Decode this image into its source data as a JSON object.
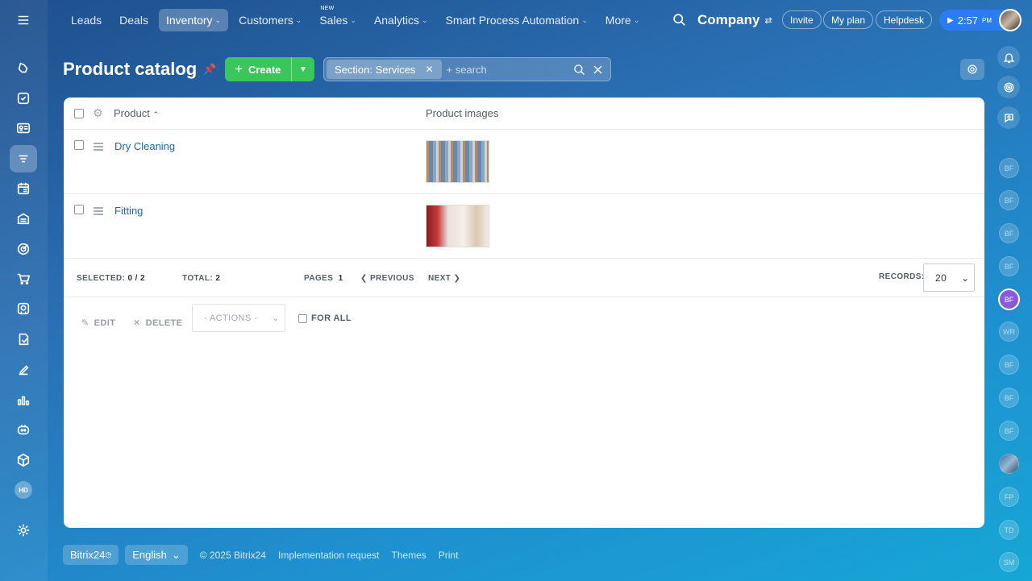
{
  "topnav": {
    "items": [
      {
        "label": "Leads",
        "chevron": false
      },
      {
        "label": "Deals",
        "chevron": false
      },
      {
        "label": "Inventory",
        "chevron": true,
        "active": true
      },
      {
        "label": "Customers",
        "chevron": true
      },
      {
        "label": "Sales",
        "chevron": true,
        "tag": "NEW"
      },
      {
        "label": "Analytics",
        "chevron": true
      },
      {
        "label": "Smart Process Automation",
        "chevron": true
      },
      {
        "label": "More",
        "chevron": true
      }
    ]
  },
  "header": {
    "company": "Company",
    "invite": "Invite",
    "my_plan": "My plan",
    "helpdesk": "Helpdesk",
    "time": "2:57",
    "ampm": "PM"
  },
  "sidebar": {
    "hd_badge": "HD"
  },
  "page": {
    "title": "Product catalog",
    "create_label": "Create",
    "filter_chip": "Section: Services",
    "search_placeholder": "+ search"
  },
  "table": {
    "col_product": "Product",
    "col_images": "Product images",
    "rows": [
      {
        "name": "Dry Cleaning"
      },
      {
        "name": "Fitting"
      }
    ]
  },
  "pager": {
    "selected_label": "SELECTED:",
    "selected_value": "0 / 2",
    "total_label": "TOTAL:",
    "total_value": "2",
    "pages_label": "PAGES",
    "pages_value": "1",
    "previous": "PREVIOUS",
    "next": "NEXT",
    "records_label": "RECORDS:",
    "records_value": "20"
  },
  "actions": {
    "edit": "EDIT",
    "delete": "DELETE",
    "actions_select": "- ACTIONS -",
    "for_all": "FOR ALL"
  },
  "rightbar": {
    "avatars": [
      "BF",
      "BF",
      "BF",
      "BF",
      "BF",
      "WR",
      "BF",
      "BF",
      "BF",
      "",
      "FP",
      "TD",
      "SM"
    ]
  },
  "footer": {
    "brand": "Bitrix24",
    "language": "English",
    "copyright": "© 2025 Bitrix24",
    "implementation": "Implementation request",
    "themes": "Themes",
    "print": "Print"
  }
}
